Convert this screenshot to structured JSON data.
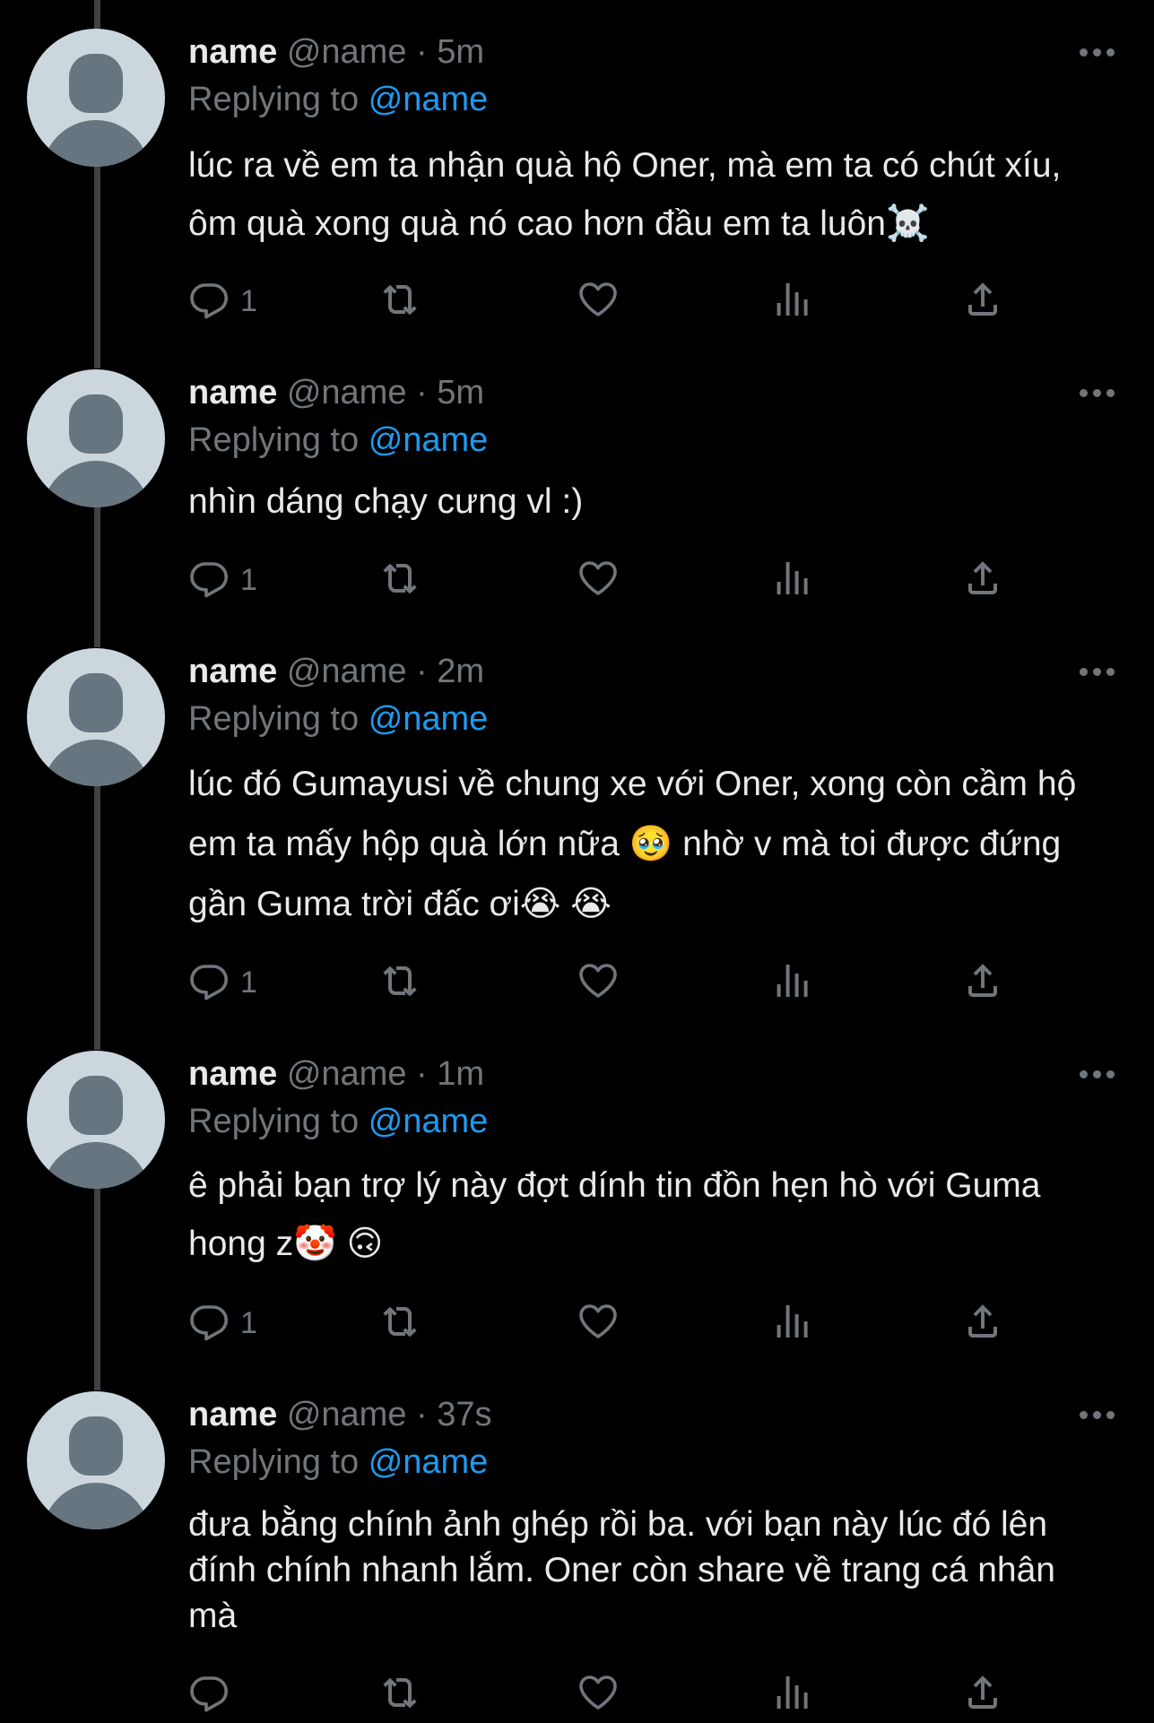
{
  "tweets": [
    {
      "name": "name",
      "handle": "@name",
      "sep": "·",
      "time": "5m",
      "replying_prefix": "Replying to",
      "replying_to": "@name",
      "text": "lúc ra về em ta nhận quà hộ Oner, mà em ta có chút xíu, ôm quà xong quà nó cao hơn đầu em ta luôn☠️",
      "reply_count": "1"
    },
    {
      "name": "name",
      "handle": "@name",
      "sep": "·",
      "time": "5m",
      "replying_prefix": "Replying to",
      "replying_to": "@name",
      "text": "nhìn dáng chạy cưng vl :)",
      "reply_count": "1"
    },
    {
      "name": "name",
      "handle": "@name",
      "sep": "·",
      "time": "2m",
      "replying_prefix": "Replying to",
      "replying_to": "@name",
      "text": "lúc đó Gumayusi về chung xe với Oner, xong còn cầm hộ em ta mấy hộp quà lớn nữa 🥹  nhờ v mà toi được đứng gần Guma trời đấc ơi😭 😭",
      "reply_count": "1"
    },
    {
      "name": "name",
      "handle": "@name",
      "sep": "·",
      "time": "1m",
      "replying_prefix": "Replying to",
      "replying_to": "@name",
      "text": "ê phải bạn trợ lý này đợt dính tin đồn hẹn hò với Guma hong z🤡 🙃",
      "reply_count": "1"
    },
    {
      "name": "name",
      "handle": "@name",
      "sep": "·",
      "time": "37s",
      "replying_prefix": "Replying to",
      "replying_to": "@name",
      "text": "đưa bằng chính ảnh ghép rồi ba. với bạn này lúc đó lên đính chính nhanh lắm. Oner còn share về trang cá nhân mà",
      "reply_count": ""
    }
  ],
  "icons": {
    "reply": "reply-icon",
    "retweet": "retweet-icon",
    "like": "like-icon",
    "views": "views-icon",
    "share": "share-icon",
    "more": "more-icon"
  },
  "colors": {
    "background": "#000000",
    "text": "#e7e9ea",
    "muted": "#71767b",
    "accent": "#1d9bf0"
  }
}
